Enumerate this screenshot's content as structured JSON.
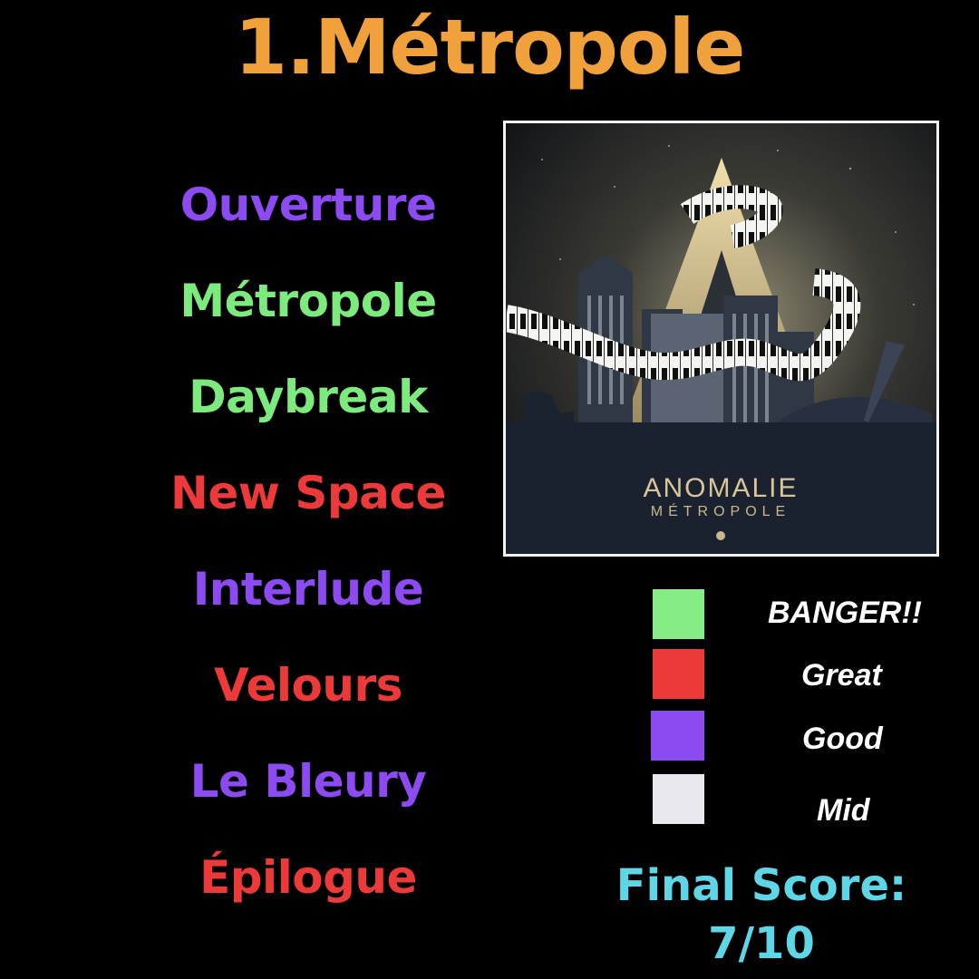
{
  "title": "1.Métropole",
  "tracks": [
    {
      "name": "Ouverture",
      "color": "#8c4bf0"
    },
    {
      "name": "Métropole",
      "color": "#7dea7d"
    },
    {
      "name": "Daybreak",
      "color": "#7dea7d"
    },
    {
      "name": "New Space",
      "color": "#ec3a3a"
    },
    {
      "name": "Interlude",
      "color": "#8c4bf0"
    },
    {
      "name": "Velours",
      "color": "#ec3a3a"
    },
    {
      "name": "Le Bleury",
      "color": "#8c4bf0"
    },
    {
      "name": "Épilogue",
      "color": "#ec3a3a"
    }
  ],
  "album_cover": {
    "artist": "ANOMALIE",
    "album": "MÉTROPOLE"
  },
  "legend": [
    {
      "label": "BANGER!!",
      "color": "#86ec86"
    },
    {
      "label": "Great",
      "color": "#ec3a3a"
    },
    {
      "label": "Good",
      "color": "#8c4bf0"
    },
    {
      "label": "Mid",
      "color": "#e8e8ee"
    }
  ],
  "final_score": {
    "label": "Final Score:",
    "value": "7/10"
  }
}
